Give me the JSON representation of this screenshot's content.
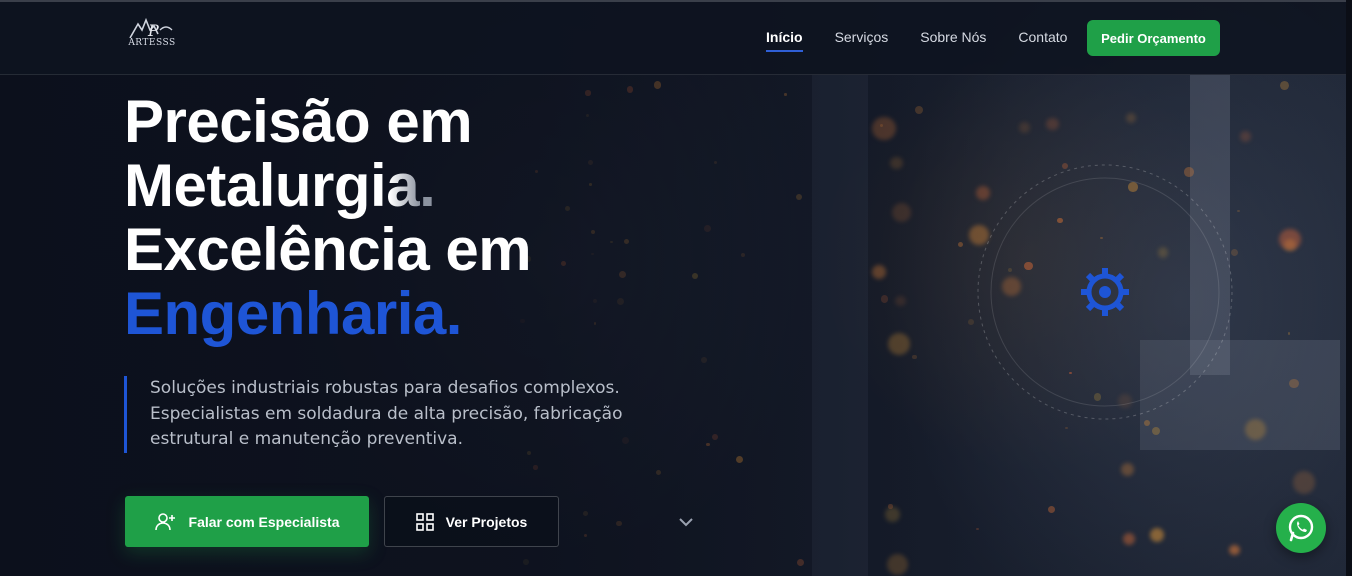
{
  "brand": {
    "logo_text": "ARTESSS"
  },
  "nav": {
    "links": [
      {
        "label": "Início",
        "active": true
      },
      {
        "label": "Serviços",
        "active": false
      },
      {
        "label": "Sobre Nós",
        "active": false
      },
      {
        "label": "Contato",
        "active": false
      }
    ],
    "cta_label": "Pedir Orçamento"
  },
  "hero": {
    "line1": "Precisão em",
    "line2_a": "Metalur",
    "line2_b": "gia.",
    "line3": "Excelência em",
    "line4": "Engenharia.",
    "lead_lines": [
      "Soluções industriais robustas para desafios complexos.",
      "Especialistas em soldadura de alta precisão, fabricação",
      "estrutural e manutenção preventiva."
    ],
    "primary_button": "Falar com Especialista",
    "secondary_button": "Ver Projetos"
  },
  "colors": {
    "accent_blue": "#1e55d6",
    "accent_green": "#1fa048",
    "background": "#0e1320"
  },
  "icons": {
    "primary_button_icon": "user-add-icon",
    "secondary_button_icon": "grid-icon",
    "scroll_icon": "chevron-down-icon",
    "orbit_icon": "gear-icon",
    "float_icon": "whatsapp-icon"
  }
}
